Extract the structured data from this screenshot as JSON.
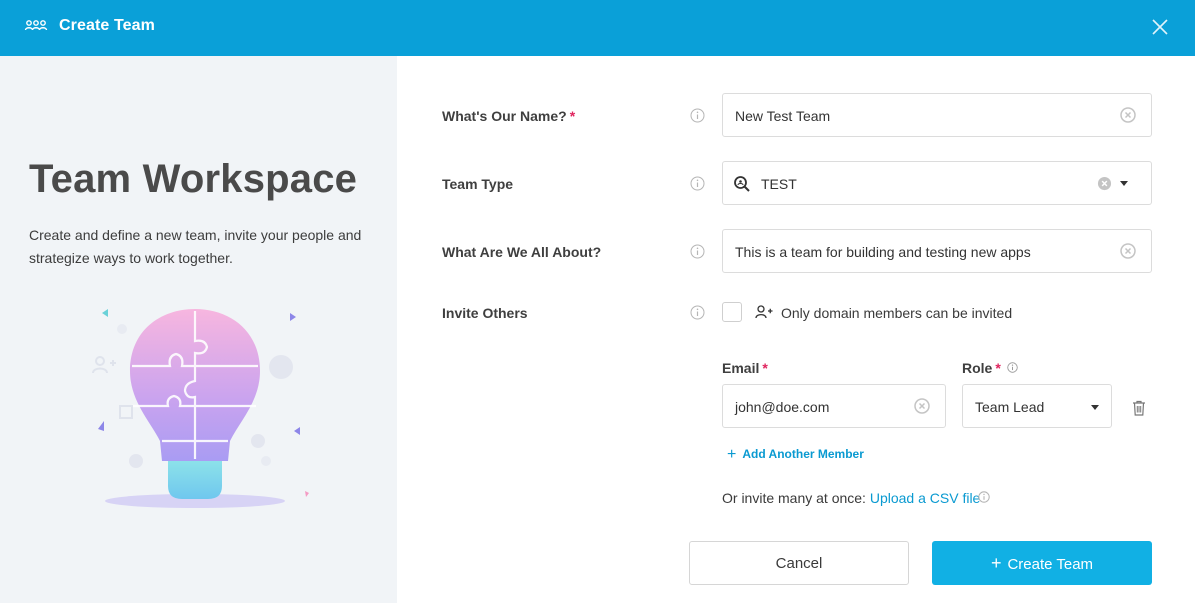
{
  "header": {
    "title": "Create Team",
    "icon": "team-icon",
    "close_icon": "close-icon"
  },
  "left": {
    "heading": "Team Workspace",
    "description": "Create and define a new team, invite your people and strategize ways to work together.",
    "illustration": "lightbulb-puzzle-illustration"
  },
  "form": {
    "name": {
      "label": "What's Our Name?",
      "required": "*",
      "value": "New Test Team"
    },
    "type": {
      "label": "Team Type",
      "value": "TEST"
    },
    "about": {
      "label": "What Are We All About?",
      "value": "This is a team for building and testing new apps"
    },
    "invite": {
      "label": "Invite Others",
      "domain_only_text": "Only domain members can be invited",
      "checked": false,
      "email_label": "Email",
      "email_required": "*",
      "email_value": "john@doe.com",
      "role_label": "Role",
      "role_required": "*",
      "role_value": "Team Lead",
      "add_member": "Add Another Member",
      "csv_prefix": "Or invite many at once:",
      "csv_link": "Upload a CSV file"
    }
  },
  "buttons": {
    "cancel": "Cancel",
    "create": "Create Team",
    "create_plus": "+"
  },
  "colors": {
    "header": "#0aa0d8",
    "accent": "#0a9ad1",
    "primary_button": "#11b0e4",
    "required": "#e0245e",
    "left_panel": "#f1f4f7"
  }
}
